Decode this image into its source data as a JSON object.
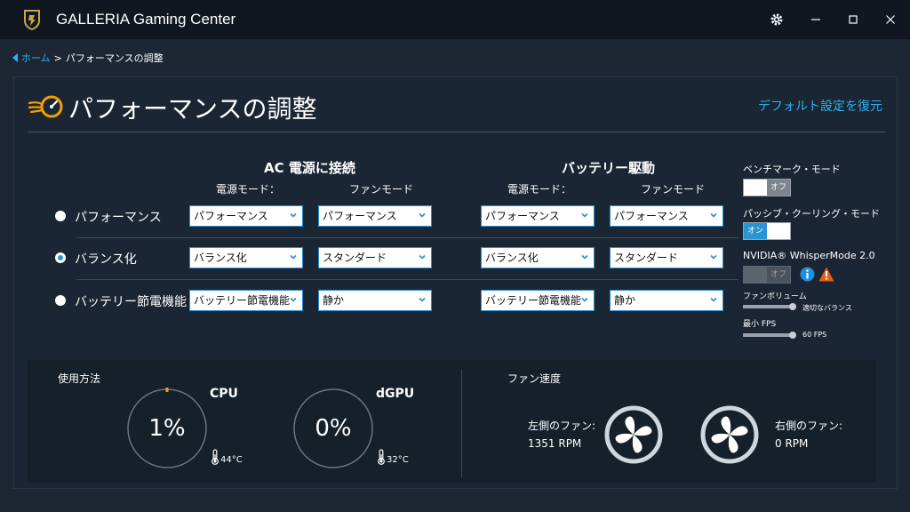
{
  "app": {
    "title": "GALLERIA Gaming Center"
  },
  "breadcrumb": {
    "home": "ホーム",
    "separator": ">",
    "current": "パフォーマンスの調整"
  },
  "page": {
    "title": "パフォーマンスの調整",
    "restore_default": "デフォルト設定を復元"
  },
  "ac": {
    "title": "AC 電源に接続",
    "power_mode_label": "電源モード：",
    "fan_mode_label": "ファンモード"
  },
  "battery": {
    "title": "バッテリー駆動",
    "power_mode_label": "電源モード：",
    "fan_mode_label": "ファンモード"
  },
  "profiles": [
    {
      "label": "パフォーマンス",
      "selected": false,
      "ac_power": "パフォーマンス",
      "ac_fan": "パフォーマンス",
      "bat_power": "パフォーマンス",
      "bat_fan": "パフォーマンス"
    },
    {
      "label": "バランス化",
      "selected": true,
      "ac_power": "バランス化",
      "ac_fan": "スタンダード",
      "bat_power": "バランス化",
      "bat_fan": "スタンダード"
    },
    {
      "label": "バッテリー節電機能",
      "selected": false,
      "ac_power": "バッテリー節電機能",
      "ac_fan": "静か",
      "bat_power": "バッテリー節電機能",
      "bat_fan": "静か"
    }
  ],
  "settings": {
    "benchmark": {
      "label": "ベンチマーク・モード",
      "state": "オフ"
    },
    "passive_cooling": {
      "label": "パッシブ・クーリング・モード",
      "state": "オン"
    },
    "whisper": {
      "label": "NVIDIA® WhisperMode 2.0",
      "state": "オフ"
    },
    "fan_volume": {
      "label": "ファンボリューム",
      "value": "適切なバランス",
      "level": 1.0
    },
    "min_fps": {
      "label": "最小 FPS",
      "value": "60 FPS",
      "level": 1.0
    }
  },
  "usage": {
    "title": "使用方法",
    "cpu": {
      "label": "CPU",
      "value": "1%",
      "temp": "44°C",
      "percent": 1
    },
    "gpu": {
      "label": "dGPU",
      "value": "0%",
      "temp": "32°C",
      "percent": 0
    }
  },
  "fans": {
    "title": "ファン速度",
    "left": {
      "label": "左側のファン:",
      "rpm": "1351 RPM"
    },
    "right": {
      "label": "右側のファン:",
      "rpm": "0 RPM"
    }
  },
  "colors": {
    "accent": "#2fb0f0",
    "toggle_on": "#2a95d6",
    "gauge_marker": "#e8a317",
    "warning": "#e85d1a"
  }
}
